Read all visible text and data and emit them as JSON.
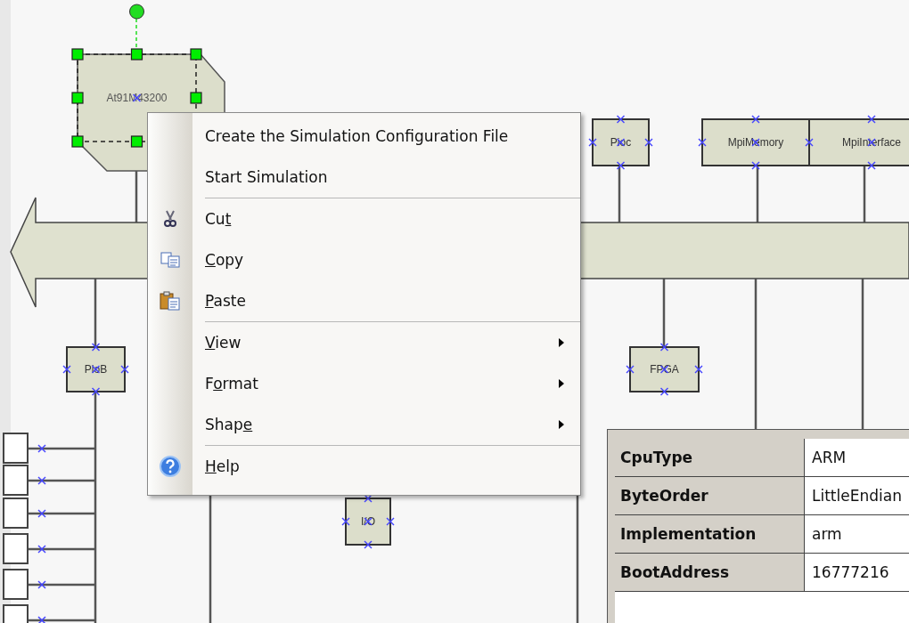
{
  "diagram": {
    "nodes": [
      {
        "label": "At91M43200",
        "kind": "chip",
        "selected": true
      },
      {
        "label": "Pioc",
        "kind": "box",
        "selected": false
      },
      {
        "label": "MpiMemory",
        "kind": "box",
        "selected": false
      },
      {
        "label": "MpiInterface",
        "kind": "box",
        "selected": false
      },
      {
        "label": "PioB",
        "kind": "box",
        "selected": false
      },
      {
        "label": "FPGA",
        "kind": "box",
        "selected": false
      },
      {
        "label": "I/O",
        "kind": "box",
        "selected": false
      }
    ]
  },
  "context_menu": {
    "items": [
      {
        "kind": "item",
        "label": "Create the Simulation Configuration File"
      },
      {
        "kind": "item",
        "label": "Start Simulation"
      },
      {
        "kind": "separator"
      },
      {
        "kind": "item",
        "label": "Cu",
        "access_key": "t"
      },
      {
        "kind": "item",
        "access_key": "C",
        "label_rest": "opy"
      },
      {
        "kind": "item",
        "access_key": "P",
        "label_rest": "aste"
      },
      {
        "kind": "separator"
      },
      {
        "kind": "item",
        "access_key": "V",
        "label_rest": "iew",
        "submenu": true
      },
      {
        "kind": "item",
        "label": "F",
        "access_key": "o",
        "label_rest": "rmat",
        "submenu": true
      },
      {
        "kind": "item",
        "label": "Shap",
        "access_key": "e",
        "submenu": true
      },
      {
        "kind": "separator"
      },
      {
        "kind": "item",
        "access_key": "H",
        "label_rest": "elp"
      }
    ]
  },
  "properties": {
    "rows": [
      {
        "name": "CpuType",
        "value": "ARM"
      },
      {
        "name": "ByteOrder",
        "value": "LittleEndian"
      },
      {
        "name": "Implementation",
        "value": "arm"
      },
      {
        "name": "BootAddress",
        "value": "16777216"
      }
    ]
  }
}
